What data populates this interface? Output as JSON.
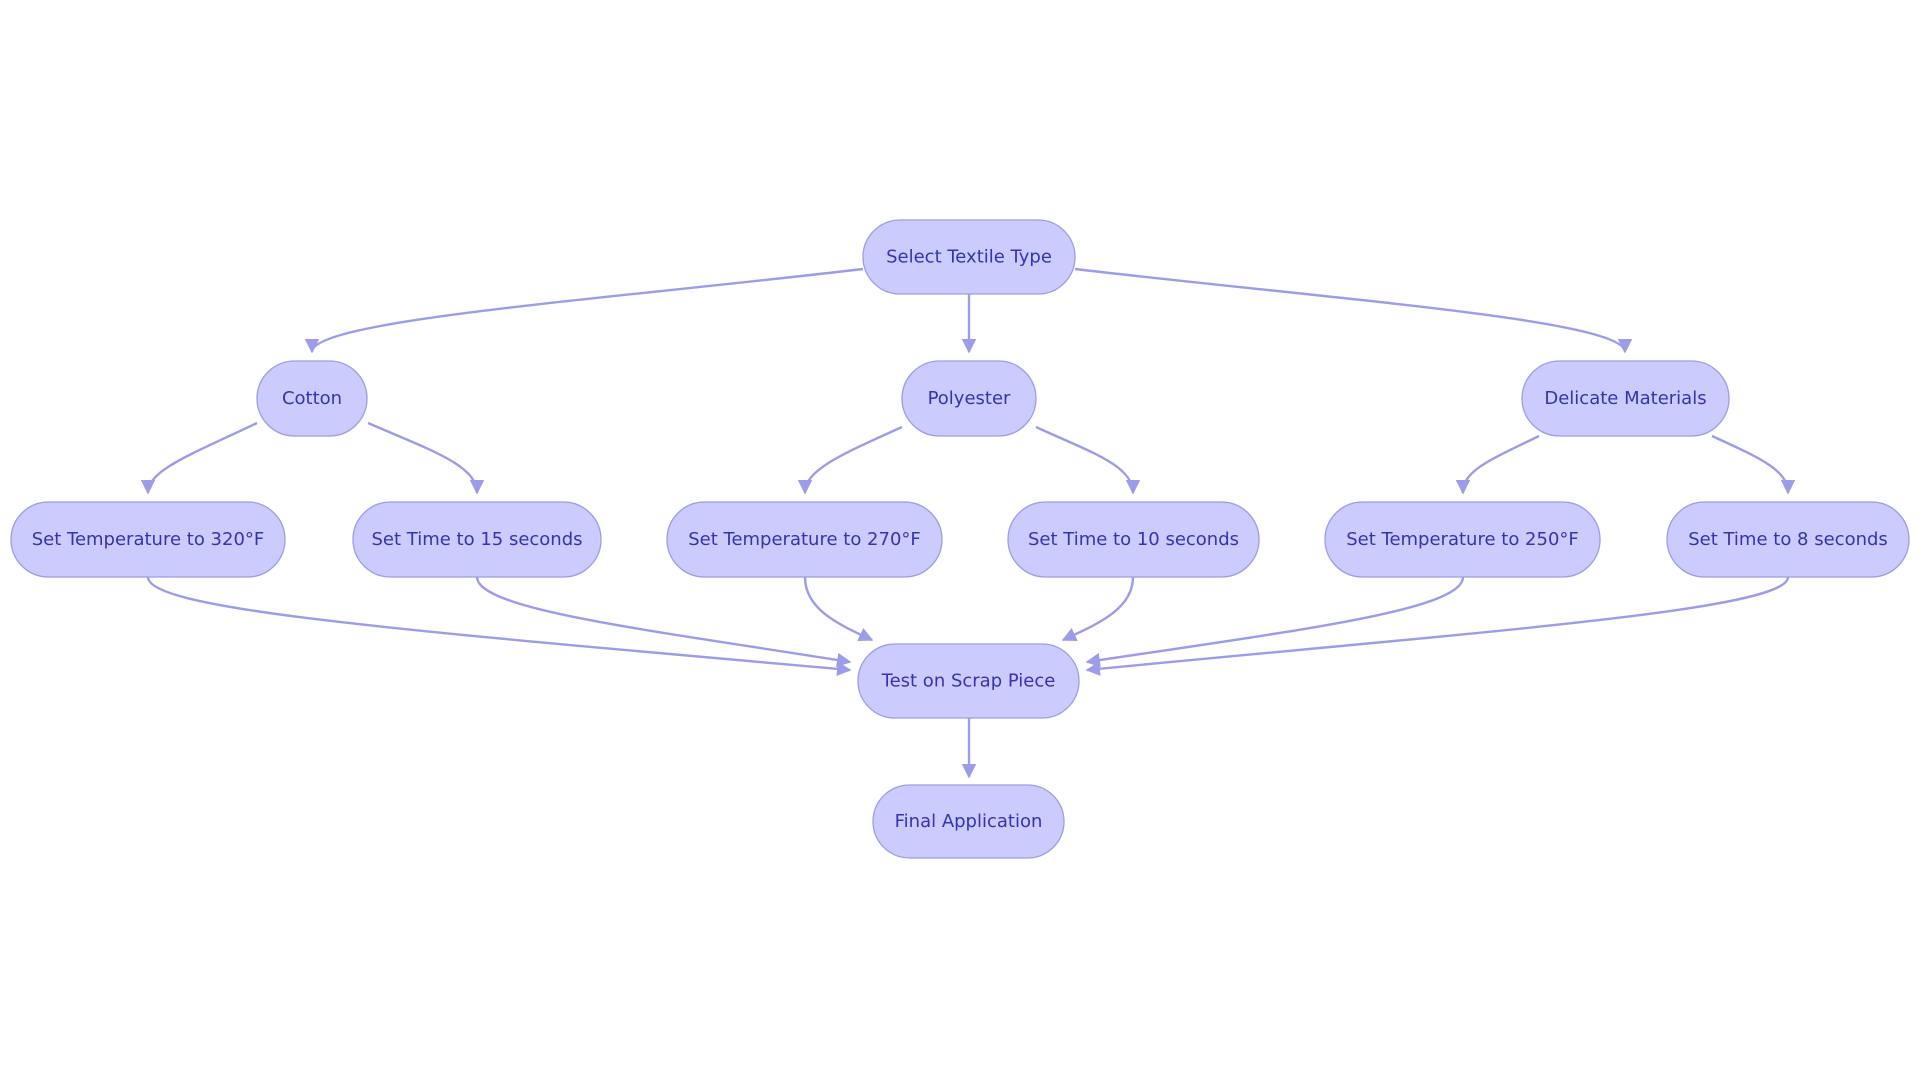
{
  "diagram": {
    "type": "flowchart",
    "colors": {
      "node_fill": "#CBCBFD",
      "node_stroke": "#9C9CE8",
      "text": "#3434AE",
      "edge": "#9C9CE8"
    },
    "nodes": [
      {
        "id": "select",
        "label": "Select Textile Type"
      },
      {
        "id": "cotton",
        "label": "Cotton"
      },
      {
        "id": "polyester",
        "label": "Polyester"
      },
      {
        "id": "delicate",
        "label": "Delicate Materials"
      },
      {
        "id": "t320",
        "label": "Set Temperature to 320°F"
      },
      {
        "id": "time15",
        "label": "Set Time to 15 seconds"
      },
      {
        "id": "t270",
        "label": "Set Temperature to 270°F"
      },
      {
        "id": "time10",
        "label": "Set Time to 10 seconds"
      },
      {
        "id": "t250",
        "label": "Set Temperature to 250°F"
      },
      {
        "id": "time8",
        "label": "Set Time to 8 seconds"
      },
      {
        "id": "test",
        "label": "Test on Scrap Piece"
      },
      {
        "id": "final",
        "label": "Final Application"
      }
    ],
    "edges": [
      {
        "from": "select",
        "to": "cotton"
      },
      {
        "from": "select",
        "to": "polyester"
      },
      {
        "from": "select",
        "to": "delicate"
      },
      {
        "from": "cotton",
        "to": "t320"
      },
      {
        "from": "cotton",
        "to": "time15"
      },
      {
        "from": "polyester",
        "to": "t270"
      },
      {
        "from": "polyester",
        "to": "time10"
      },
      {
        "from": "delicate",
        "to": "t250"
      },
      {
        "from": "delicate",
        "to": "time8"
      },
      {
        "from": "t320",
        "to": "test"
      },
      {
        "from": "time15",
        "to": "test"
      },
      {
        "from": "t270",
        "to": "test"
      },
      {
        "from": "time10",
        "to": "test"
      },
      {
        "from": "t250",
        "to": "test"
      },
      {
        "from": "time8",
        "to": "test"
      },
      {
        "from": "test",
        "to": "final"
      }
    ]
  }
}
